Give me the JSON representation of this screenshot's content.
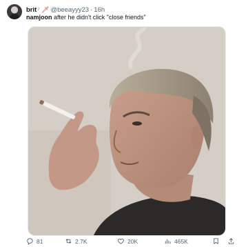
{
  "author": {
    "display_name": "brit",
    "emoji": "⁷ 🗡",
    "handle": "@beeayyy23",
    "separator": "·",
    "time": "16h"
  },
  "tweet": {
    "text_bold": "namjoon",
    "text_rest": " after he didn't click \"close friends\""
  },
  "actions": {
    "replies": "81",
    "retweets": "2.7K",
    "likes": "20K",
    "views": "465K"
  },
  "icons": {
    "reply": "reply-icon",
    "retweet": "retweet-icon",
    "like": "heart-icon",
    "views": "views-icon",
    "bookmark": "bookmark-icon"
  },
  "colors": {
    "text_primary": "#0f1419",
    "text_secondary": "#536471"
  }
}
